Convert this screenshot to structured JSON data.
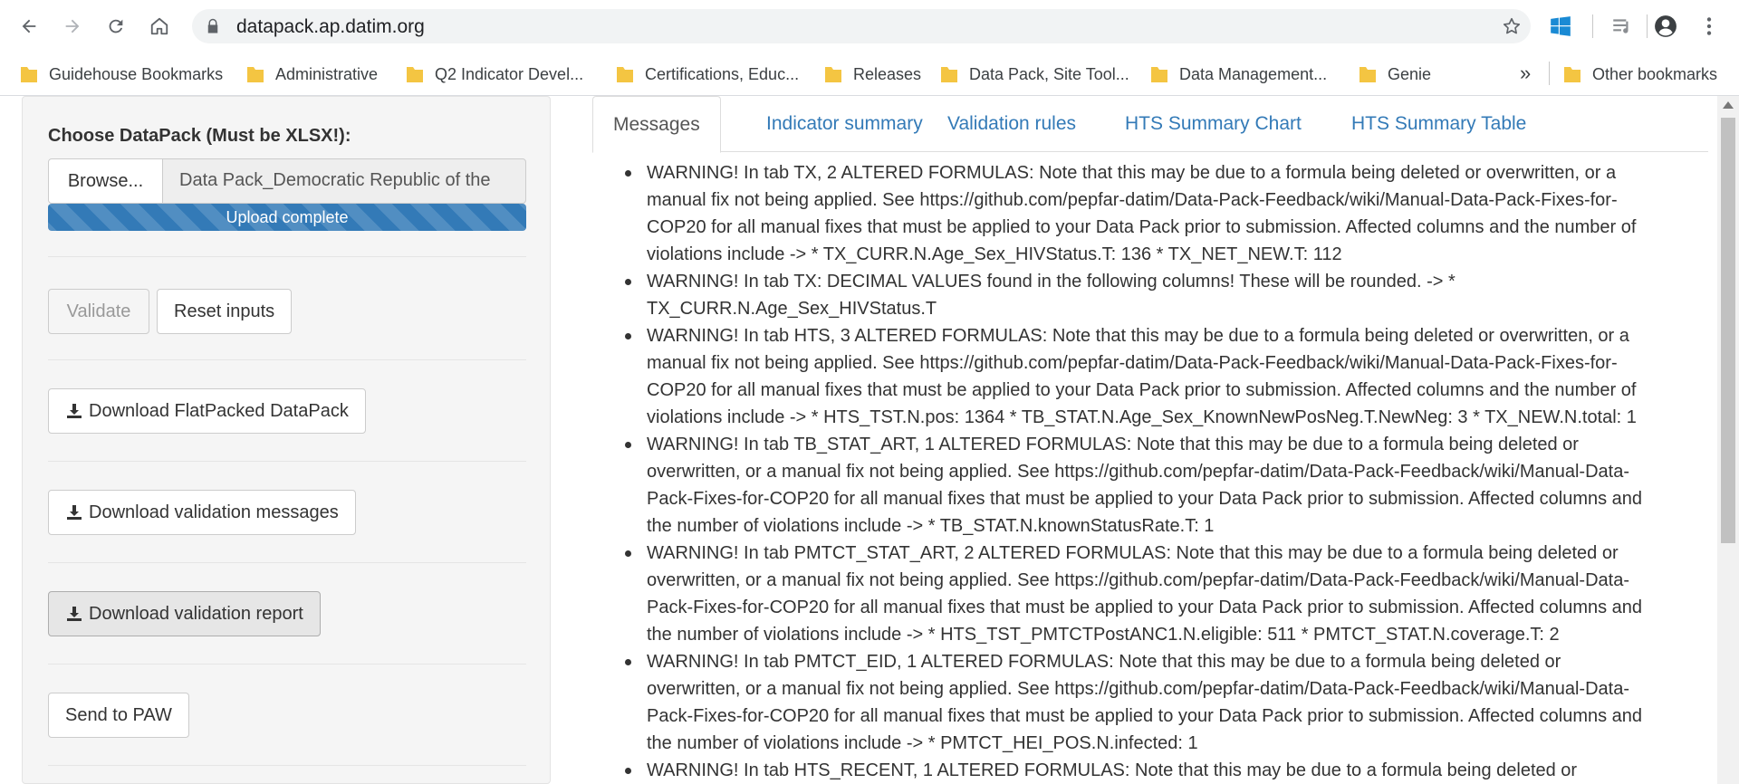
{
  "browser": {
    "url": "datapack.ap.datim.org",
    "bookmarks": [
      {
        "label": "Guidehouse Bookmarks"
      },
      {
        "label": "Administrative"
      },
      {
        "label": "Q2 Indicator Devel..."
      },
      {
        "label": "Certifications, Educ..."
      },
      {
        "label": "Releases"
      },
      {
        "label": "Data Pack, Site Tool..."
      },
      {
        "label": "Data Management..."
      },
      {
        "label": "Genie"
      }
    ],
    "more_label": "»",
    "other_bookmarks": "Other bookmarks",
    "folder_color": "#f4c542"
  },
  "sidebar": {
    "choose_label": "Choose DataPack (Must be XLSX!):",
    "browse_label": "Browse...",
    "file_name": "Data Pack_Democratic Republic of the",
    "upload_status": "Upload complete",
    "upload_progress": 1.0,
    "validate_label": "Validate",
    "reset_label": "Reset inputs",
    "download_flatpacked_label": "Download FlatPacked DataPack",
    "download_messages_label": "Download validation messages",
    "download_report_label": "Download validation report",
    "send_paw_label": "Send to PAW"
  },
  "tabs": [
    {
      "label": "Messages",
      "active": true
    },
    {
      "label": "Indicator summary"
    },
    {
      "label": "Validation rules"
    },
    {
      "label": "HTS Summary Chart"
    },
    {
      "label": "HTS Summary Table"
    }
  ],
  "messages": [
    {
      "lines": [
        "WARNING! In tab TX, 2 ALTERED FORMULAS: Note that this may be due to a formula being deleted or overwritten, or a",
        "manual fix not being applied. See https://github.com/pepfar-datim/Data-Pack-Feedback/wiki/Manual-Data-Pack-Fixes-for-",
        "COP20 for all manual fixes that must be applied to your Data Pack prior to submission. Affected columns and the number of",
        "violations include -> * TX_CURR.N.Age_Sex_HIVStatus.T: 136 * TX_NET_NEW.T: 112"
      ]
    },
    {
      "lines": [
        "WARNING! In tab TX: DECIMAL VALUES found in the following columns! These will be rounded. -> *",
        "TX_CURR.N.Age_Sex_HIVStatus.T"
      ]
    },
    {
      "lines": [
        "WARNING! In tab HTS, 3 ALTERED FORMULAS: Note that this may be due to a formula being deleted or overwritten, or a",
        "manual fix not being applied. See https://github.com/pepfar-datim/Data-Pack-Feedback/wiki/Manual-Data-Pack-Fixes-for-",
        "COP20 for all manual fixes that must be applied to your Data Pack prior to submission. Affected columns and the number of",
        "violations include -> * HTS_TST.N.pos: 1364 * TB_STAT.N.Age_Sex_KnownNewPosNeg.T.NewNeg: 3 * TX_NEW.N.total: 1"
      ]
    },
    {
      "lines": [
        "WARNING! In tab TB_STAT_ART, 1 ALTERED FORMULAS: Note that this may be due to a formula being deleted or",
        "overwritten, or a manual fix not being applied. See https://github.com/pepfar-datim/Data-Pack-Feedback/wiki/Manual-Data-",
        "Pack-Fixes-for-COP20 for all manual fixes that must be applied to your Data Pack prior to submission. Affected columns and",
        "the number of violations include -> * TB_STAT.N.knownStatusRate.T: 1"
      ]
    },
    {
      "lines": [
        "WARNING! In tab PMTCT_STAT_ART, 2 ALTERED FORMULAS: Note that this may be due to a formula being deleted or",
        "overwritten, or a manual fix not being applied. See https://github.com/pepfar-datim/Data-Pack-Feedback/wiki/Manual-Data-",
        "Pack-Fixes-for-COP20 for all manual fixes that must be applied to your Data Pack prior to submission. Affected columns and",
        "the number of violations include -> * HTS_TST_PMTCTPostANC1.N.eligible: 511 * PMTCT_STAT.N.coverage.T: 2"
      ]
    },
    {
      "lines": [
        "WARNING! In tab PMTCT_EID, 1 ALTERED FORMULAS: Note that this may be due to a formula being deleted or",
        "overwritten, or a manual fix not being applied. See https://github.com/pepfar-datim/Data-Pack-Feedback/wiki/Manual-Data-",
        "Pack-Fixes-for-COP20 for all manual fixes that must be applied to your Data Pack prior to submission. Affected columns and",
        "the number of violations include -> * PMTCT_HEI_POS.N.infected: 1"
      ]
    },
    {
      "lines": [
        "WARNING! In tab HTS_RECENT, 1 ALTERED FORMULAS: Note that this may be due to a formula being deleted or"
      ]
    }
  ]
}
